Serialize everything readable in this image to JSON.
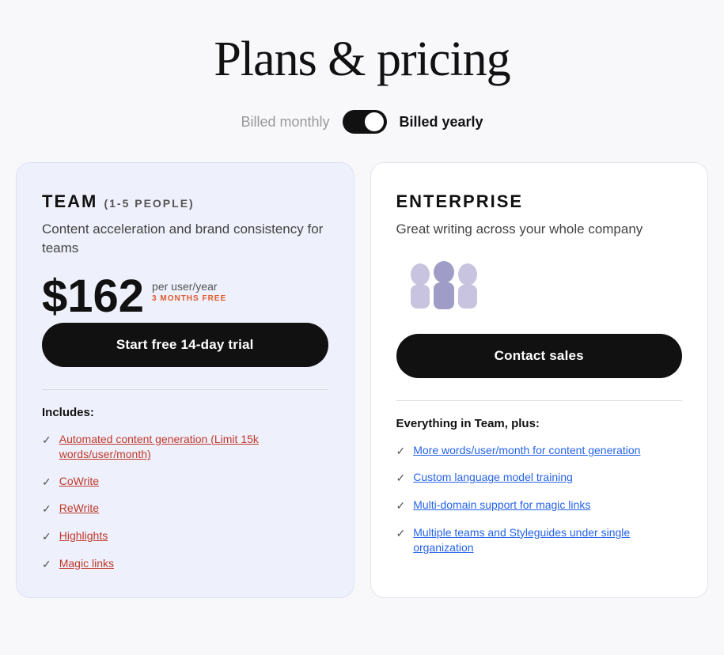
{
  "page": {
    "title": "Plans & pricing"
  },
  "billing": {
    "monthly_label": "Billed monthly",
    "yearly_label": "Billed yearly",
    "toggle_state": "yearly"
  },
  "plans": [
    {
      "id": "team",
      "name": "TEAM",
      "people_range": "(1-5 PEOPLE)",
      "description": "Content acceleration and brand consistency for teams",
      "price": "$162",
      "price_per": "per user/year",
      "promo": "3 MONTHS FREE",
      "cta_label": "Start free 14-day trial",
      "includes_label": "Includes:",
      "features": [
        {
          "text": "Automated content generation (Limit 15k words/user/month)",
          "link": true,
          "color": "red"
        },
        {
          "text": "CoWrite",
          "link": true,
          "color": "red"
        },
        {
          "text": "ReWrite",
          "link": true,
          "color": "red"
        },
        {
          "text": "Highlights",
          "link": true,
          "color": "red"
        },
        {
          "text": "Magic links",
          "link": true,
          "color": "red"
        }
      ]
    },
    {
      "id": "enterprise",
      "name": "ENTERPRISE",
      "description": "Great writing across your whole company",
      "price": null,
      "cta_label": "Contact sales",
      "includes_label": "Everything in Team, plus:",
      "features": [
        {
          "text": "More words/user/month for content generation",
          "link": true,
          "color": "blue"
        },
        {
          "text": "Custom language model training",
          "link": true,
          "color": "blue"
        },
        {
          "text": "Multi-domain support for magic links",
          "link": true,
          "color": "blue"
        },
        {
          "text": "Multiple teams and Styleguides under single organization",
          "link": true,
          "color": "blue"
        }
      ]
    }
  ]
}
